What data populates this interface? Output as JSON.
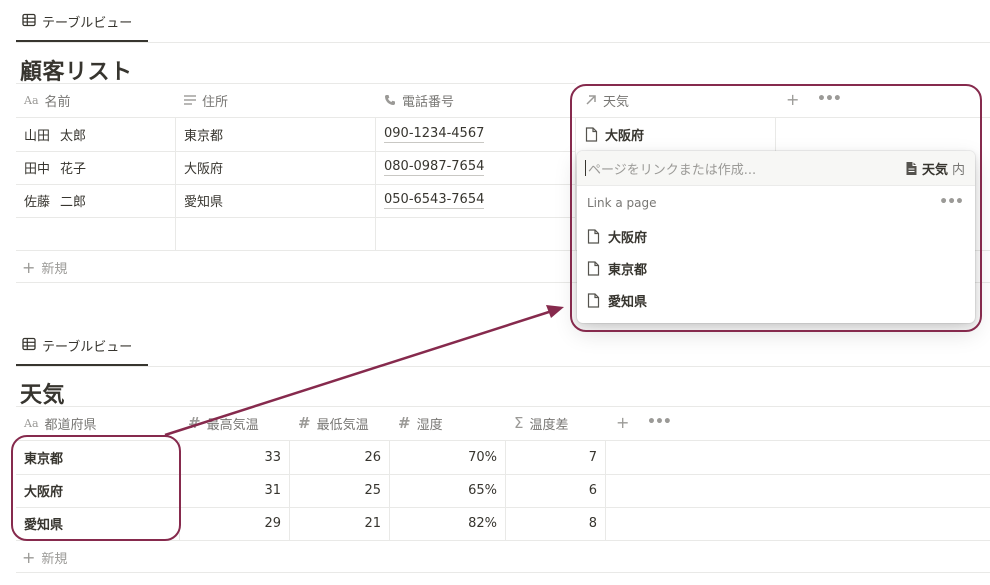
{
  "colors": {
    "accent": "#862a4d",
    "text": "#37352f",
    "muted": "#787774",
    "border": "#e9e9e7"
  },
  "top_db": {
    "view_tab": "テーブルビュー",
    "title": "顧客リスト",
    "columns": [
      {
        "icon": "text-type-icon",
        "label": "名前"
      },
      {
        "icon": "lines-icon",
        "label": "住所"
      },
      {
        "icon": "phone-icon",
        "label": "電話番号"
      },
      {
        "icon": "relation-arrow-icon",
        "label": "天気"
      }
    ],
    "rows": [
      {
        "last": "山田",
        "first": "太郎",
        "address": "東京都",
        "phone": "090-1234-4567"
      },
      {
        "last": "田中",
        "first": "花子",
        "address": "大阪府",
        "phone": "080-0987-7654"
      },
      {
        "last": "佐藤",
        "first": "二郎",
        "address": "愛知県",
        "phone": "050-6543-7654"
      }
    ],
    "relation_value": "大阪府",
    "new_label": "新規"
  },
  "popup": {
    "placeholder": "ページをリンクまたは作成...",
    "scope_db": "天気",
    "scope_suffix": "内",
    "section_label": "Link a page",
    "options": [
      "大阪府",
      "東京都",
      "愛知県"
    ]
  },
  "bottom_db": {
    "view_tab": "テーブルビュー",
    "title": "天気",
    "columns": [
      {
        "icon": "text-type-icon",
        "label": "都道府県"
      },
      {
        "icon": "number-icon",
        "label": "最高気温"
      },
      {
        "icon": "number-icon",
        "label": "最低気温"
      },
      {
        "icon": "number-icon",
        "label": "湿度"
      },
      {
        "icon": "formula-sigma-icon",
        "label": "温度差"
      }
    ],
    "rows": [
      {
        "pref": "東京都",
        "high": "33",
        "low": "26",
        "humidity": "70%",
        "diff": "7"
      },
      {
        "pref": "大阪府",
        "high": "31",
        "low": "25",
        "humidity": "65%",
        "diff": "6"
      },
      {
        "pref": "愛知県",
        "high": "29",
        "low": "21",
        "humidity": "82%",
        "diff": "8"
      }
    ],
    "new_label": "新規"
  }
}
